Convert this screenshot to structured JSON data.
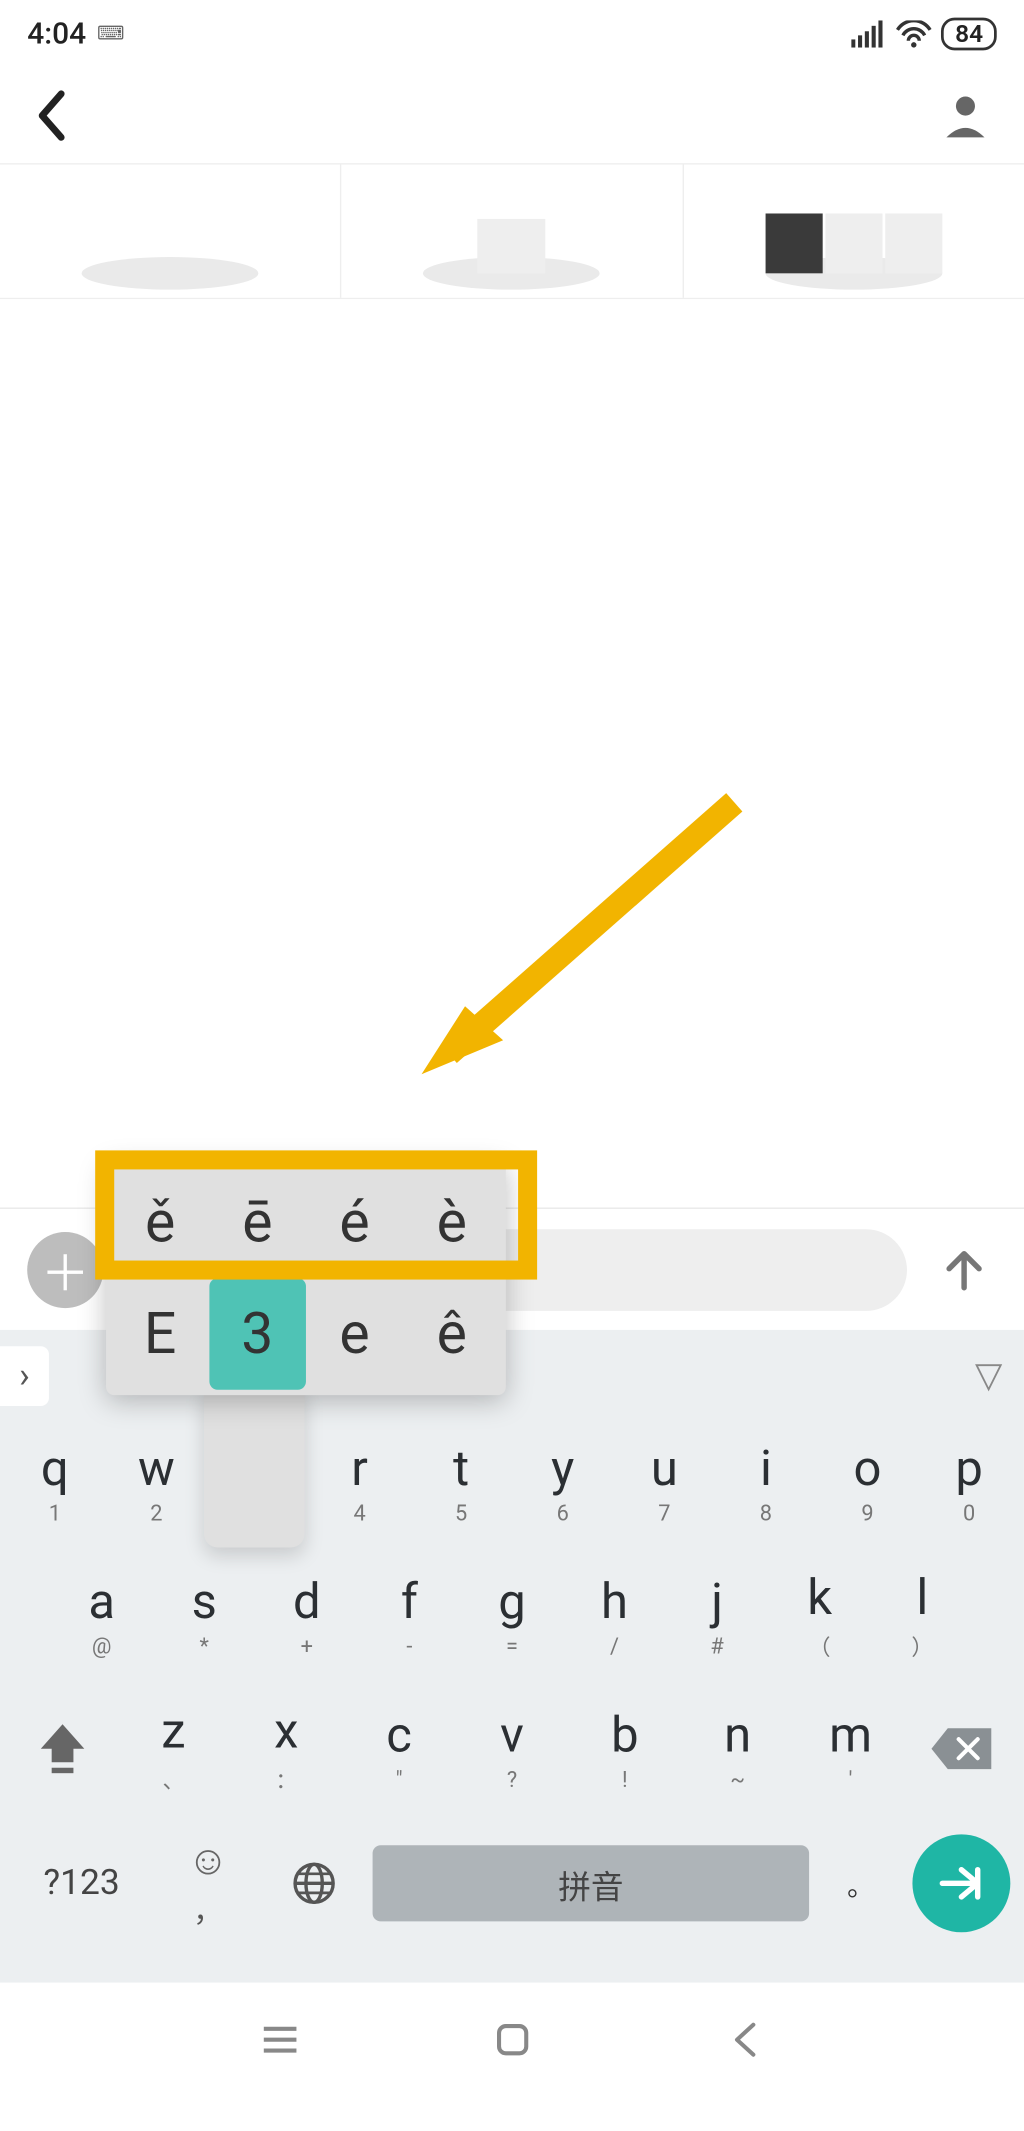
{
  "status": {
    "time": "4:04",
    "battery": "84"
  },
  "input": {
    "placeholder": ""
  },
  "accent_popup": {
    "row1": [
      "ě",
      "ē",
      "é",
      "è"
    ],
    "row2": [
      "E",
      "3",
      "e",
      "ê"
    ],
    "active_index": 5
  },
  "keyboard": {
    "row1": [
      {
        "main": "q",
        "sub": "1"
      },
      {
        "main": "w",
        "sub": "2"
      },
      {
        "main": "e",
        "sub": "3"
      },
      {
        "main": "r",
        "sub": "4"
      },
      {
        "main": "t",
        "sub": "5"
      },
      {
        "main": "y",
        "sub": "6"
      },
      {
        "main": "u",
        "sub": "7"
      },
      {
        "main": "i",
        "sub": "8"
      },
      {
        "main": "o",
        "sub": "9"
      },
      {
        "main": "p",
        "sub": "0"
      }
    ],
    "row2": [
      {
        "main": "a",
        "sub": "@"
      },
      {
        "main": "s",
        "sub": "*"
      },
      {
        "main": "d",
        "sub": "+"
      },
      {
        "main": "f",
        "sub": "-"
      },
      {
        "main": "g",
        "sub": "="
      },
      {
        "main": "h",
        "sub": "/"
      },
      {
        "main": "j",
        "sub": "#"
      },
      {
        "main": "k",
        "sub": "（"
      },
      {
        "main": "l",
        "sub": "）"
      }
    ],
    "row3": [
      {
        "main": "z",
        "sub": "、"
      },
      {
        "main": "x",
        "sub": "："
      },
      {
        "main": "c",
        "sub": "\""
      },
      {
        "main": "v",
        "sub": "?"
      },
      {
        "main": "b",
        "sub": "!"
      },
      {
        "main": "n",
        "sub": "~"
      },
      {
        "main": "m",
        "sub": "'"
      }
    ],
    "fn_label": "?123",
    "emoji_sub": "，",
    "space_label": "拼音",
    "period": "。"
  }
}
